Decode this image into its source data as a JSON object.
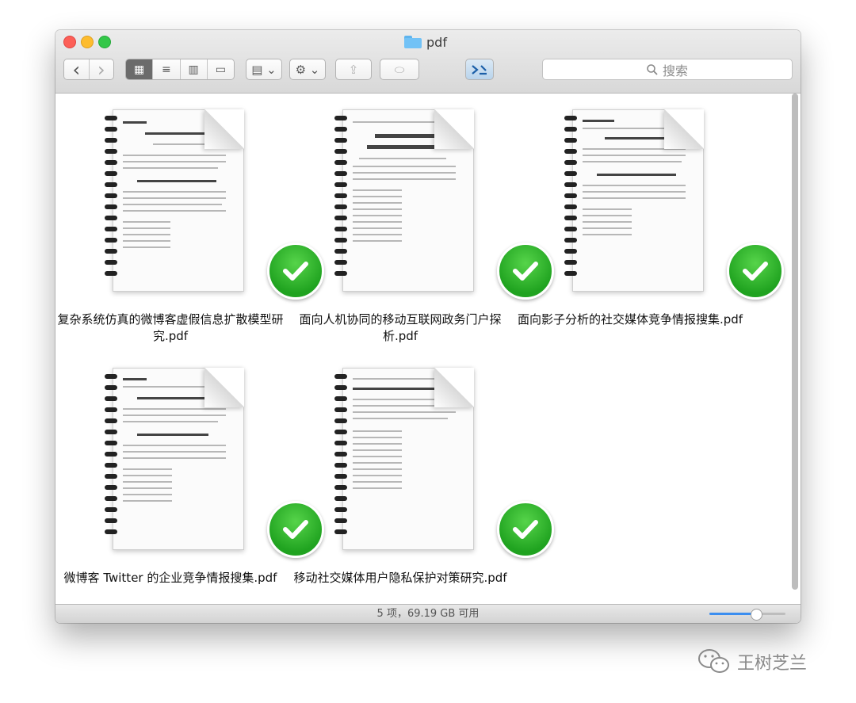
{
  "window": {
    "title": "pdf",
    "search_placeholder": "搜索",
    "status": "5 项，69.19 GB 可用",
    "zoom_level_fraction": 0.6
  },
  "toolbar": {
    "back_label": "‹",
    "forward_label": "›",
    "view_icon_label": "▦",
    "view_list_label": "≡",
    "view_columns_label": "▥",
    "view_gallery_label": "▭",
    "arrange_label": "▤ ⌄",
    "action_label": "⚙ ⌄",
    "share_label": "⇪",
    "tag_label": "⬭",
    "icons": [
      "back-arrow-icon",
      "forward-arrow-icon",
      "grid-icon",
      "list-icon",
      "columns-icon",
      "gallery-icon",
      "arrange-icon",
      "gear-icon",
      "share-icon",
      "tag-icon",
      "terminal-icon",
      "search-icon"
    ]
  },
  "files": [
    {
      "name": "复杂系统仿真的微博客虚假信息扩散模型研究.pdf",
      "status": "check-icon"
    },
    {
      "name": "面向人机协同的移动互联网政务门户探析.pdf",
      "status": "check-icon"
    },
    {
      "name": "面向影子分析的社交媒体竞争情报搜集.pdf",
      "status": "check-icon"
    },
    {
      "name": "微博客 Twitter 的企业竞争情报搜集.pdf",
      "status": "check-icon"
    },
    {
      "name": "移动社交媒体用户隐私保护对策研究.pdf",
      "status": "check-icon"
    }
  ],
  "watermark": "王树芝兰",
  "colors": {
    "check_green": "#2fb52c",
    "slider_blue": "#3b8ef0"
  }
}
